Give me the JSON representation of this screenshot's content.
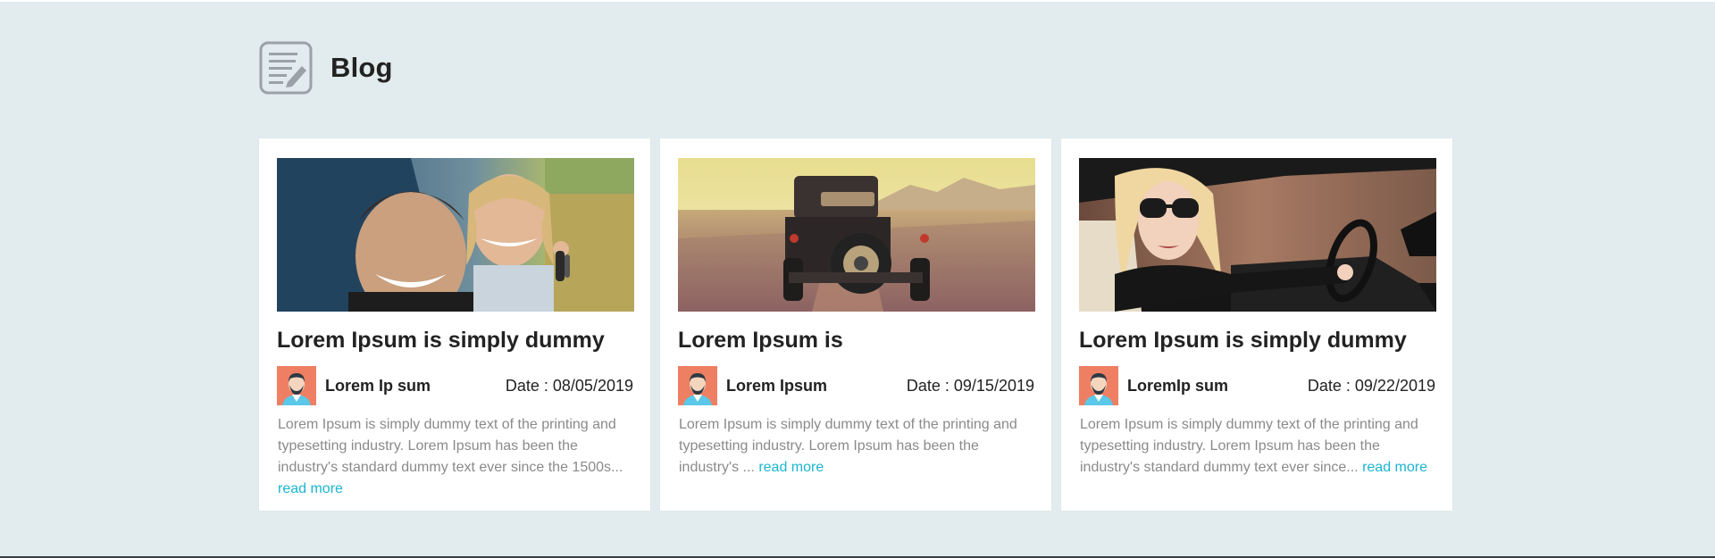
{
  "header": {
    "title": "Blog",
    "icon": "blog-edit-icon"
  },
  "colors": {
    "background": "#e2ebed",
    "card": "#ffffff",
    "link": "#1bb6cf",
    "excerpt": "#8a8a8a",
    "avatar_bg": "#ef7f62"
  },
  "posts": [
    {
      "image": "couple-in-car-with-keys",
      "title": "Lorem Ipsum is simply dummy",
      "author": "Lorem Ip sum",
      "avatar": "user-avatar-icon",
      "date": "Date : 08/05/2019",
      "excerpt": "Lorem Ipsum is simply dummy text of the printing and typesetting industry. Lorem Ipsum has been the industry's standard dummy text ever since the 1500s... ",
      "read_more": "read more"
    },
    {
      "image": "vintage-car-on-road",
      "title": "Lorem Ipsum is",
      "author": "Lorem Ipsum",
      "avatar": "user-avatar-icon",
      "date": "Date : 09/15/2019",
      "excerpt": "Lorem Ipsum is simply dummy text of the printing and typesetting industry. Lorem Ipsum has been the industry's ... ",
      "read_more": "read more"
    },
    {
      "image": "woman-driving-convertible",
      "title": "Lorem Ipsum is simply dummy",
      "author": "LoremIp sum",
      "avatar": "user-avatar-icon",
      "date": "Date : 09/22/2019",
      "excerpt": "Lorem Ipsum is simply dummy text of the printing and typesetting industry. Lorem Ipsum has been the industry's standard dummy text ever since... ",
      "read_more": "read more"
    }
  ]
}
